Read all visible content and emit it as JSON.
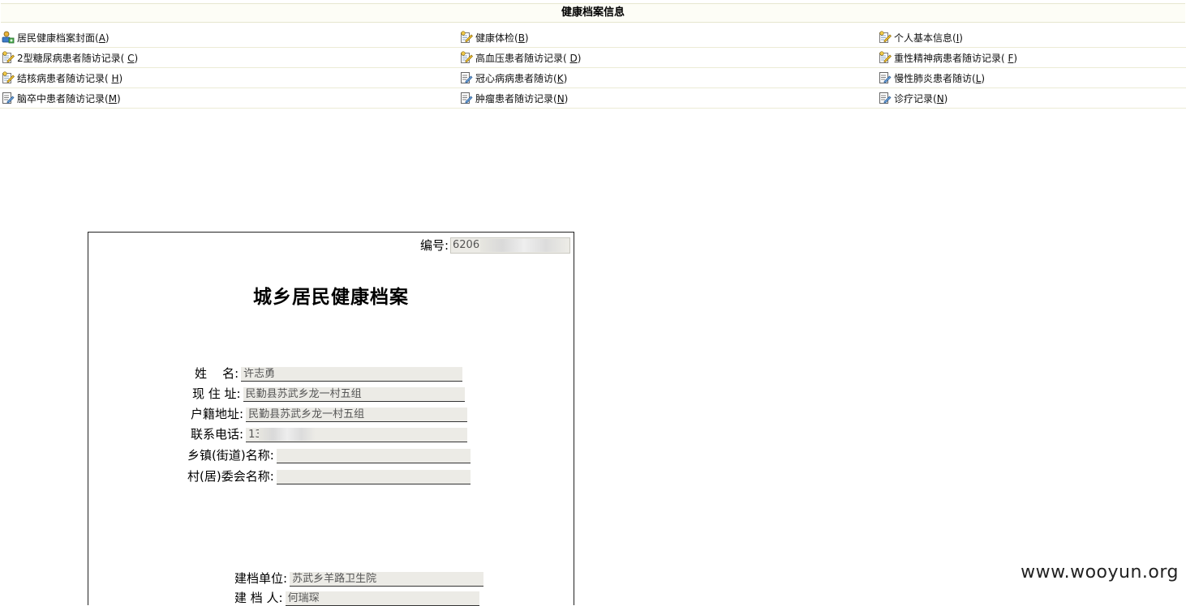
{
  "header": {
    "title": "健康档案信息"
  },
  "menu": {
    "rows": [
      [
        {
          "label": "居民健康档案封面(",
          "key": "A",
          ")": ")",
          "icon": "cover-icon"
        },
        {
          "label": "健康体检(",
          "key": "B",
          "icon": "edit-pencil-icon"
        },
        {
          "label": "个人基本信息(",
          "key": "I",
          "icon": "edit-pencil-icon"
        }
      ],
      [
        {
          "label": "2型糖尿病患者随访记录( ",
          "key": "C",
          "icon": "edit-pencil-icon"
        },
        {
          "label": "高血压患者随访记录( ",
          "key": "D",
          "icon": "edit-pencil-icon"
        },
        {
          "label": "重性精神病患者随访记录( ",
          "key": "F",
          "icon": "edit-pencil-icon"
        }
      ],
      [
        {
          "label": "结核病患者随访记录( ",
          "key": "H",
          "icon": "edit-pencil-icon"
        },
        {
          "label": "冠心病病患者随访(",
          "key": "K",
          "icon": "edit-doc-icon"
        },
        {
          "label": "慢性肺炎患者随访(",
          "key": "L",
          "icon": "edit-doc-icon"
        }
      ],
      [
        {
          "label": "脑卒中患者随访记录(",
          "key": "M",
          "icon": "edit-doc-icon"
        },
        {
          "label": "肿瘤患者随访记录(",
          "key": "N",
          "icon": "edit-doc-icon"
        },
        {
          "label": "诊疗记录(",
          "key": "N",
          "icon": "edit-doc-icon"
        }
      ]
    ],
    "close_paren": ")"
  },
  "document": {
    "number_label": "编号:",
    "number_value": "62062",
    "title": "城乡居民健康档案",
    "fields": {
      "name_label": "姓    名:",
      "name_value": "许志勇",
      "address_label": "现 住 址:",
      "address_value": "民勤县苏武乡龙一村五组",
      "household_label": "户籍地址:",
      "household_value": "民勤县苏武乡龙一村五组",
      "phone_label": "联系电话:",
      "phone_value": "13",
      "town_label": "乡镇(街道)名称:",
      "town_value": "",
      "village_label": "村(居)委会名称:",
      "village_value": "",
      "unit_label": "建档单位:",
      "unit_value": "苏武乡羊路卫生院",
      "creator_label": "建 档 人:",
      "creator_value": "何瑞琛"
    }
  },
  "watermark": "www.wooyun.org"
}
